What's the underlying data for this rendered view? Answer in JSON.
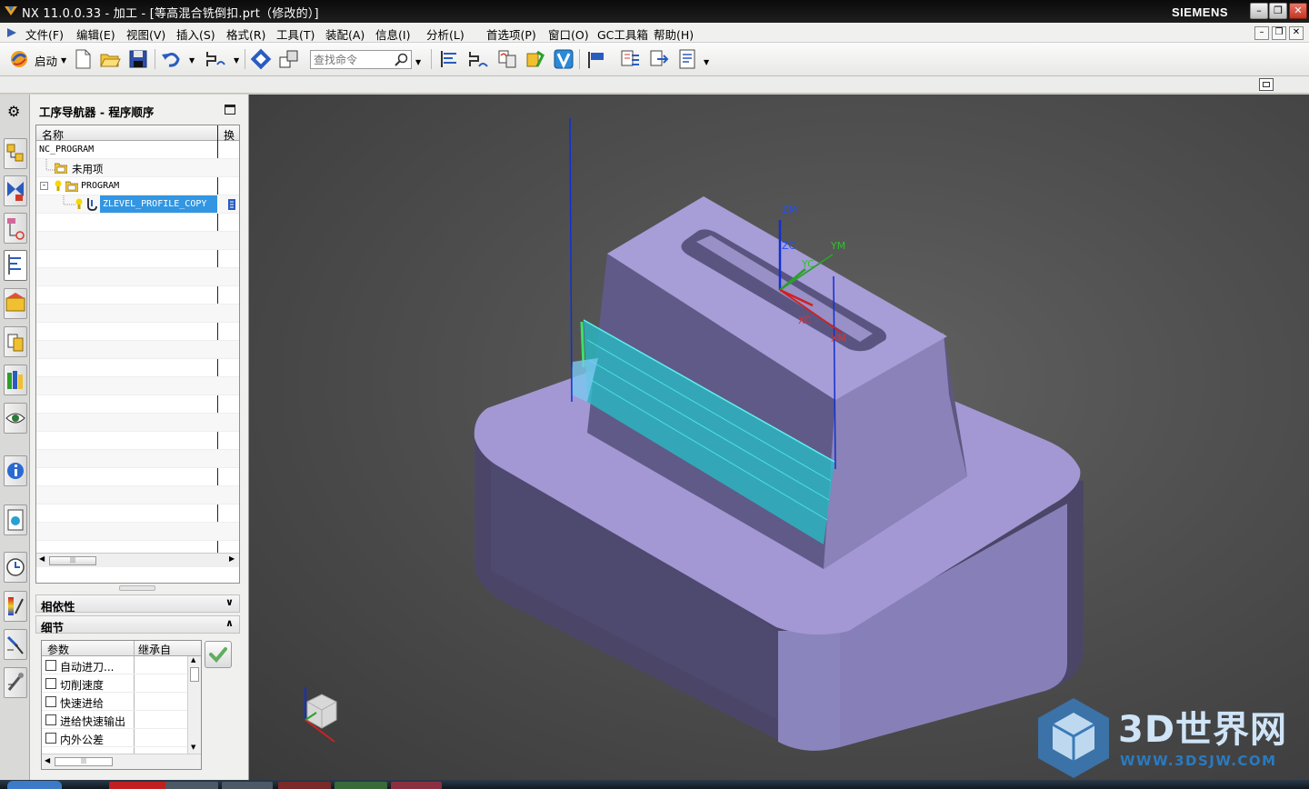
{
  "window": {
    "title": "NX 11.0.0.33 - 加工 - [等高混合铣倒扣.prt（修改的）]",
    "brand": "SIEMENS",
    "controls": [
      "minimize",
      "restore",
      "close"
    ]
  },
  "menu": {
    "items": [
      "文件(F)",
      "编辑(E)",
      "视图(V)",
      "插入(S)",
      "格式(R)",
      "工具(T)",
      "装配(A)",
      "信息(I)",
      "分析(L)",
      "首选项(P)",
      "窗口(O)",
      "GC工具箱",
      "帮助(H)"
    ]
  },
  "toolbar": {
    "start_label": "启动",
    "search_placeholder": "查找命令"
  },
  "navigator": {
    "title": "工序导航器 - 程序顺序",
    "columns": [
      "名称",
      "换"
    ],
    "rows": [
      {
        "label": "NC_PROGRAM"
      },
      {
        "label": "未用项"
      },
      {
        "label": "PROGRAM"
      },
      {
        "label": "ZLEVEL_PROFILE_COPY",
        "selected": true
      }
    ]
  },
  "panels": {
    "dependencies": "相依性",
    "details": "细节",
    "details_columns": [
      "参数",
      "继承自"
    ],
    "details_rows": [
      "自动进刀...",
      "切削速度",
      "快速进给",
      "进给快速输出",
      "内外公差"
    ]
  },
  "viewport": {
    "labels": {
      "zm": "ZM",
      "zc": "ZC",
      "ym": "YM",
      "yc": "YC",
      "xc": "XC",
      "xm": "XM"
    },
    "colors": {
      "part_top": "#a398d4",
      "part_side": "#5f5a87",
      "toolpath": "#3fd0d8",
      "axis_z": "#1030d0",
      "axis_y": "#2aa02a",
      "axis_x": "#d02020"
    }
  },
  "watermark": {
    "title": "3D世界网",
    "url": "WWW.3DSJW.COM"
  }
}
